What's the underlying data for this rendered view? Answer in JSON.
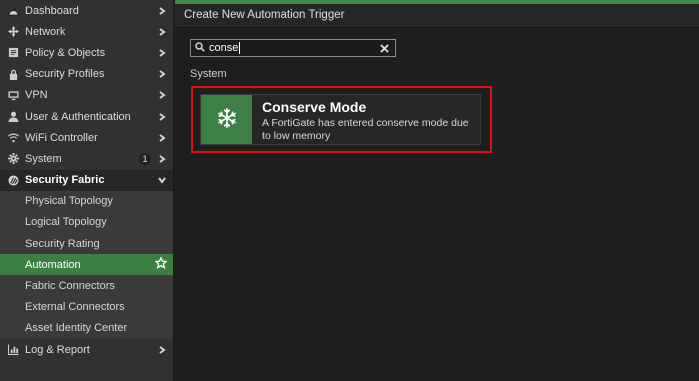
{
  "sidebar": {
    "items": [
      {
        "label": "Dashboard",
        "icon": "dashboard-icon"
      },
      {
        "label": "Network",
        "icon": "network-icon"
      },
      {
        "label": "Policy & Objects",
        "icon": "policy-icon"
      },
      {
        "label": "Security Profiles",
        "icon": "lock-icon"
      },
      {
        "label": "VPN",
        "icon": "monitor-icon"
      },
      {
        "label": "User & Authentication",
        "icon": "user-icon"
      },
      {
        "label": "WiFi Controller",
        "icon": "wifi-icon"
      },
      {
        "label": "System",
        "icon": "gear-icon",
        "badge": "1"
      }
    ],
    "section": {
      "label": "Security Fabric",
      "icon": "security-fabric-icon"
    },
    "sub_items": [
      {
        "label": "Physical Topology"
      },
      {
        "label": "Logical Topology"
      },
      {
        "label": "Security Rating"
      },
      {
        "label": "Automation"
      },
      {
        "label": "Fabric Connectors"
      },
      {
        "label": "External Connectors"
      },
      {
        "label": "Asset Identity Center"
      }
    ],
    "footer_item": {
      "label": "Log & Report",
      "icon": "chart-icon"
    }
  },
  "main": {
    "title": "Create New Automation Trigger",
    "search": {
      "value": "conse"
    },
    "group_label": "System",
    "card": {
      "title": "Conserve Mode",
      "description": "A FortiGate has entered conserve mode due to low memory",
      "icon": "snowflake-icon"
    }
  },
  "colors": {
    "accent_green": "#3c7f43",
    "highlight_red": "#e01010",
    "sidebar_bg": "#313131",
    "main_bg": "#1e1e1e"
  }
}
